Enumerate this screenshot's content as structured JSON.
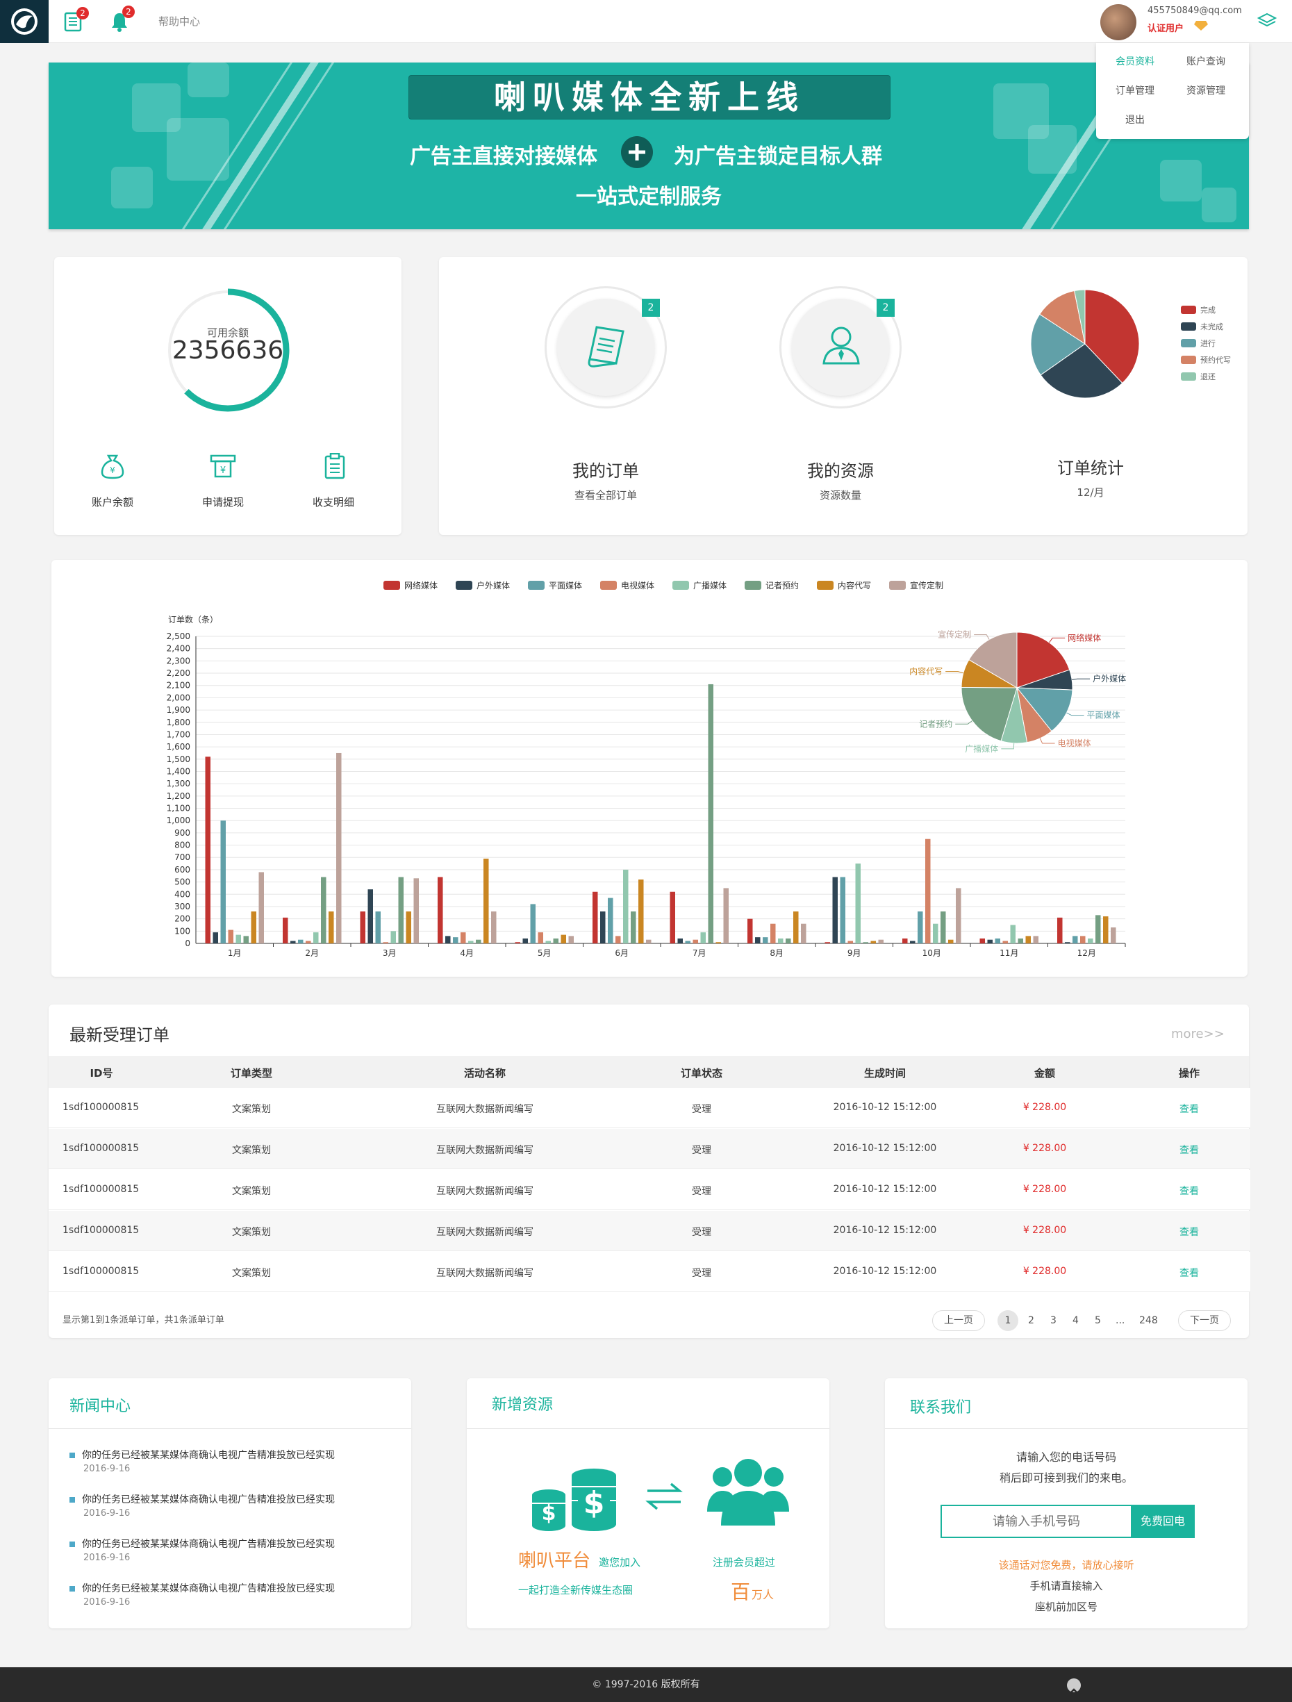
{
  "topbar": {
    "badge_orders": "2",
    "badge_notice": "2",
    "help": "帮助中心",
    "user_email": "455750849@qq.com",
    "user_status": "认证用户"
  },
  "user_menu": {
    "items": [
      "会员资料",
      "账户查询",
      "订单管理",
      "资源管理",
      "退出"
    ]
  },
  "banner": {
    "title": "喇叭媒体全新上线",
    "line1_left": "广告主直接对接媒体",
    "line1_right": "为广告主锁定目标人群",
    "line2": "一站式定制服务"
  },
  "balance": {
    "label": "可用余额",
    "value": "2356636",
    "actions": [
      "账户余额",
      "申请提现",
      "收支明细"
    ]
  },
  "summary": {
    "orders": {
      "badge": "2",
      "title": "我的订单",
      "sub": "查看全部订单"
    },
    "resources": {
      "badge": "2",
      "title": "我的资源",
      "sub": "资源数量"
    },
    "stats": {
      "title": "订单统计",
      "sub": "12/月"
    }
  },
  "mini_pie": {
    "legend": [
      "完成",
      "未完成",
      "进行",
      "预约代写",
      "退还"
    ],
    "values": [
      36,
      26,
      18,
      12,
      3
    ],
    "colors": [
      "#c23531",
      "#2f4554",
      "#61a0a8",
      "#d48265",
      "#91c7ae"
    ]
  },
  "chart_data": {
    "type": "bar",
    "ylabel": "订单数（条）",
    "ylim": [
      0,
      2500
    ],
    "ytick_step": 100,
    "grid": true,
    "legend_position": "top",
    "categories": [
      "1月",
      "2月",
      "3月",
      "4月",
      "5月",
      "6月",
      "7月",
      "8月",
      "9月",
      "10月",
      "11月",
      "12月"
    ],
    "series": [
      {
        "name": "网络媒体",
        "color": "#c23531",
        "values": [
          1520,
          210,
          260,
          540,
          10,
          420,
          420,
          200,
          10,
          40,
          40,
          210
        ]
      },
      {
        "name": "户外媒体",
        "color": "#2f4554",
        "values": [
          90,
          20,
          440,
          60,
          40,
          260,
          40,
          50,
          540,
          20,
          30,
          10
        ]
      },
      {
        "name": "平面媒体",
        "color": "#61a0a8",
        "values": [
          1000,
          30,
          260,
          50,
          320,
          370,
          20,
          50,
          540,
          260,
          40,
          60
        ]
      },
      {
        "name": "电视媒体",
        "color": "#d48265",
        "values": [
          110,
          20,
          10,
          90,
          90,
          60,
          30,
          160,
          20,
          850,
          20,
          60
        ]
      },
      {
        "name": "广播媒体",
        "color": "#91c7ae",
        "values": [
          70,
          90,
          100,
          20,
          20,
          600,
          90,
          40,
          650,
          160,
          150,
          40
        ]
      },
      {
        "name": "记者预约",
        "color": "#749f83",
        "values": [
          60,
          540,
          540,
          30,
          40,
          260,
          2110,
          40,
          10,
          260,
          40,
          230
        ]
      },
      {
        "name": "内容代写",
        "color": "#ca8622",
        "values": [
          260,
          260,
          260,
          690,
          70,
          520,
          10,
          260,
          20,
          30,
          60,
          220
        ]
      },
      {
        "name": "宣传定制",
        "color": "#bda29a",
        "values": [
          580,
          1550,
          530,
          260,
          60,
          30,
          450,
          160,
          30,
          450,
          60,
          130
        ]
      }
    ],
    "pie": {
      "labels": [
        "网络媒体",
        "户外媒体",
        "平面媒体",
        "电视媒体",
        "广播媒体",
        "记者预约",
        "内容代写",
        "宣传定制"
      ],
      "values": [
        4050,
        1200,
        2800,
        1600,
        1550,
        4200,
        1700,
        3400
      ]
    }
  },
  "orders_table": {
    "title": "最新受理订单",
    "more": "more>>",
    "headers": [
      "ID号",
      "订单类型",
      "活动名称",
      "订单状态",
      "生成时间",
      "金额",
      "操作"
    ],
    "rows": [
      [
        "1sdf100000815",
        "文案策划",
        "互联网大数据新闻编写",
        "受理",
        "2016-10-12 15:12:00",
        "¥ 228.00",
        "查看"
      ],
      [
        "1sdf100000815",
        "文案策划",
        "互联网大数据新闻编写",
        "受理",
        "2016-10-12 15:12:00",
        "¥ 228.00",
        "查看"
      ],
      [
        "1sdf100000815",
        "文案策划",
        "互联网大数据新闻编写",
        "受理",
        "2016-10-12 15:12:00",
        "¥ 228.00",
        "查看"
      ],
      [
        "1sdf100000815",
        "文案策划",
        "互联网大数据新闻编写",
        "受理",
        "2016-10-12 15:12:00",
        "¥ 228.00",
        "查看"
      ],
      [
        "1sdf100000815",
        "文案策划",
        "互联网大数据新闻编写",
        "受理",
        "2016-10-12 15:12:00",
        "¥ 228.00",
        "查看"
      ]
    ],
    "summary": "显示第1到1条派单订单，共1条派单订单",
    "prev": "上一页",
    "next": "下一页",
    "pages": [
      "1",
      "2",
      "3",
      "4",
      "5",
      "...",
      "248"
    ]
  },
  "news": {
    "title": "新闻中心",
    "items": [
      {
        "text": "你的任务已经被某某媒体商确认电视广告精准投放已经实现",
        "date": "2016-9-16"
      },
      {
        "text": "你的任务已经被某某媒体商确认电视广告精准投放已经实现",
        "date": "2016-9-16"
      },
      {
        "text": "你的任务已经被某某媒体商确认电视广告精准投放已经实现",
        "date": "2016-9-16"
      },
      {
        "text": "你的任务已经被某某媒体商确认电视广告精准投放已经实现",
        "date": "2016-9-16"
      }
    ]
  },
  "resources_card": {
    "title": "新增资源",
    "platform": "喇叭平台",
    "invite": "邀您加入",
    "slogan": "一起打造全新传媒生态圈",
    "members_pre": "注册会员超过",
    "members_big": "百",
    "members_unit": "万人"
  },
  "contact": {
    "title": "联系我们",
    "line1": "请输入您的电话号码",
    "line2": "稍后即可接到我们的来电。",
    "placeholder": "请输入手机号码",
    "button": "免费回电",
    "note1": "该通话对您免费，请放心接听",
    "note2": "手机请直接输入",
    "note3": "座机前加区号"
  },
  "footer": {
    "copyright": "© 1997-2016 版权所有"
  }
}
